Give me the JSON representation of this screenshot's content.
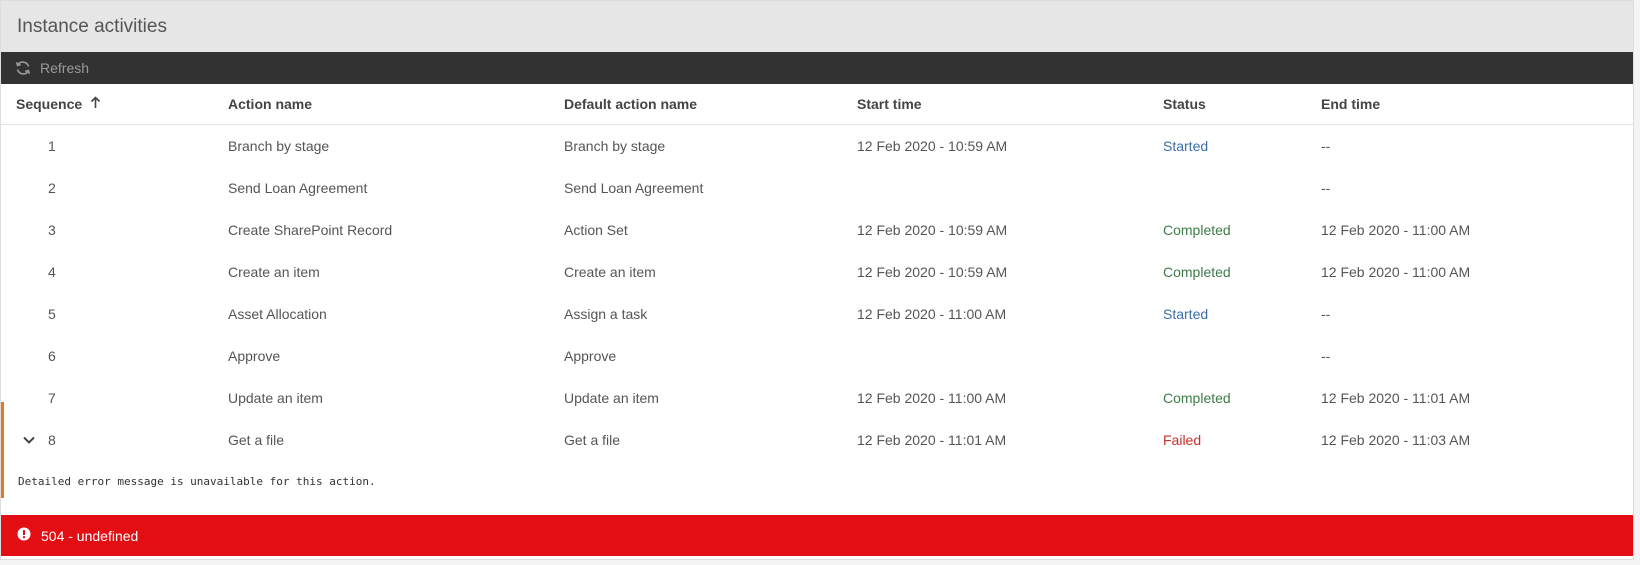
{
  "panel": {
    "title": "Instance activities"
  },
  "toolbar": {
    "refresh_label": "Refresh",
    "refresh_icon": "refresh-icon"
  },
  "table": {
    "columns": {
      "sequence": "Sequence",
      "action_name": "Action name",
      "default_action_name": "Default action name",
      "start_time": "Start time",
      "status": "Status",
      "end_time": "End time"
    },
    "sort_icon": "arrow-up-icon",
    "rows": [
      {
        "seq": "1",
        "action": "Branch by stage",
        "default": "Branch by stage",
        "start": "12 Feb 2020 - 10:59 AM",
        "status": "Started",
        "end": "--"
      },
      {
        "seq": "2",
        "action": "Send Loan Agreement",
        "default": "Send Loan Agreement",
        "start": "",
        "status": "",
        "end": "--"
      },
      {
        "seq": "3",
        "action": "Create SharePoint Record",
        "default": "Action Set",
        "start": "12 Feb 2020 - 10:59 AM",
        "status": "Completed",
        "end": "12 Feb 2020 - 11:00 AM"
      },
      {
        "seq": "4",
        "action": "Create an item",
        "default": "Create an item",
        "start": "12 Feb 2020 - 10:59 AM",
        "status": "Completed",
        "end": "12 Feb 2020 - 11:00 AM"
      },
      {
        "seq": "5",
        "action": "Asset Allocation",
        "default": "Assign a task",
        "start": "12 Feb 2020 - 11:00 AM",
        "status": "Started",
        "end": "--"
      },
      {
        "seq": "6",
        "action": "Approve",
        "default": "Approve",
        "start": "",
        "status": "",
        "end": "--"
      },
      {
        "seq": "7",
        "action": "Update an item",
        "default": "Update an item",
        "start": "12 Feb 2020 - 11:00 AM",
        "status": "Completed",
        "end": "12 Feb 2020 - 11:01 AM"
      },
      {
        "seq": "8",
        "action": "Get a file",
        "default": "Get a file",
        "start": "12 Feb 2020 - 11:01 AM",
        "status": "Failed",
        "end": "12 Feb 2020 - 11:03 AM"
      }
    ],
    "expanded_row_detail": "Detailed error message is unavailable for this action."
  },
  "error_banner": {
    "message": "504 - undefined",
    "icon": "alert-circle-icon"
  },
  "colors": {
    "title_bar_bg": "#e6e6e6",
    "toolbar_bg": "#323232",
    "status_started": "#3a6ea8",
    "status_completed": "#3f7a4a",
    "status_failed": "#c9302c",
    "expanded_accent": "#e87722",
    "error_bg": "#e20e13"
  }
}
